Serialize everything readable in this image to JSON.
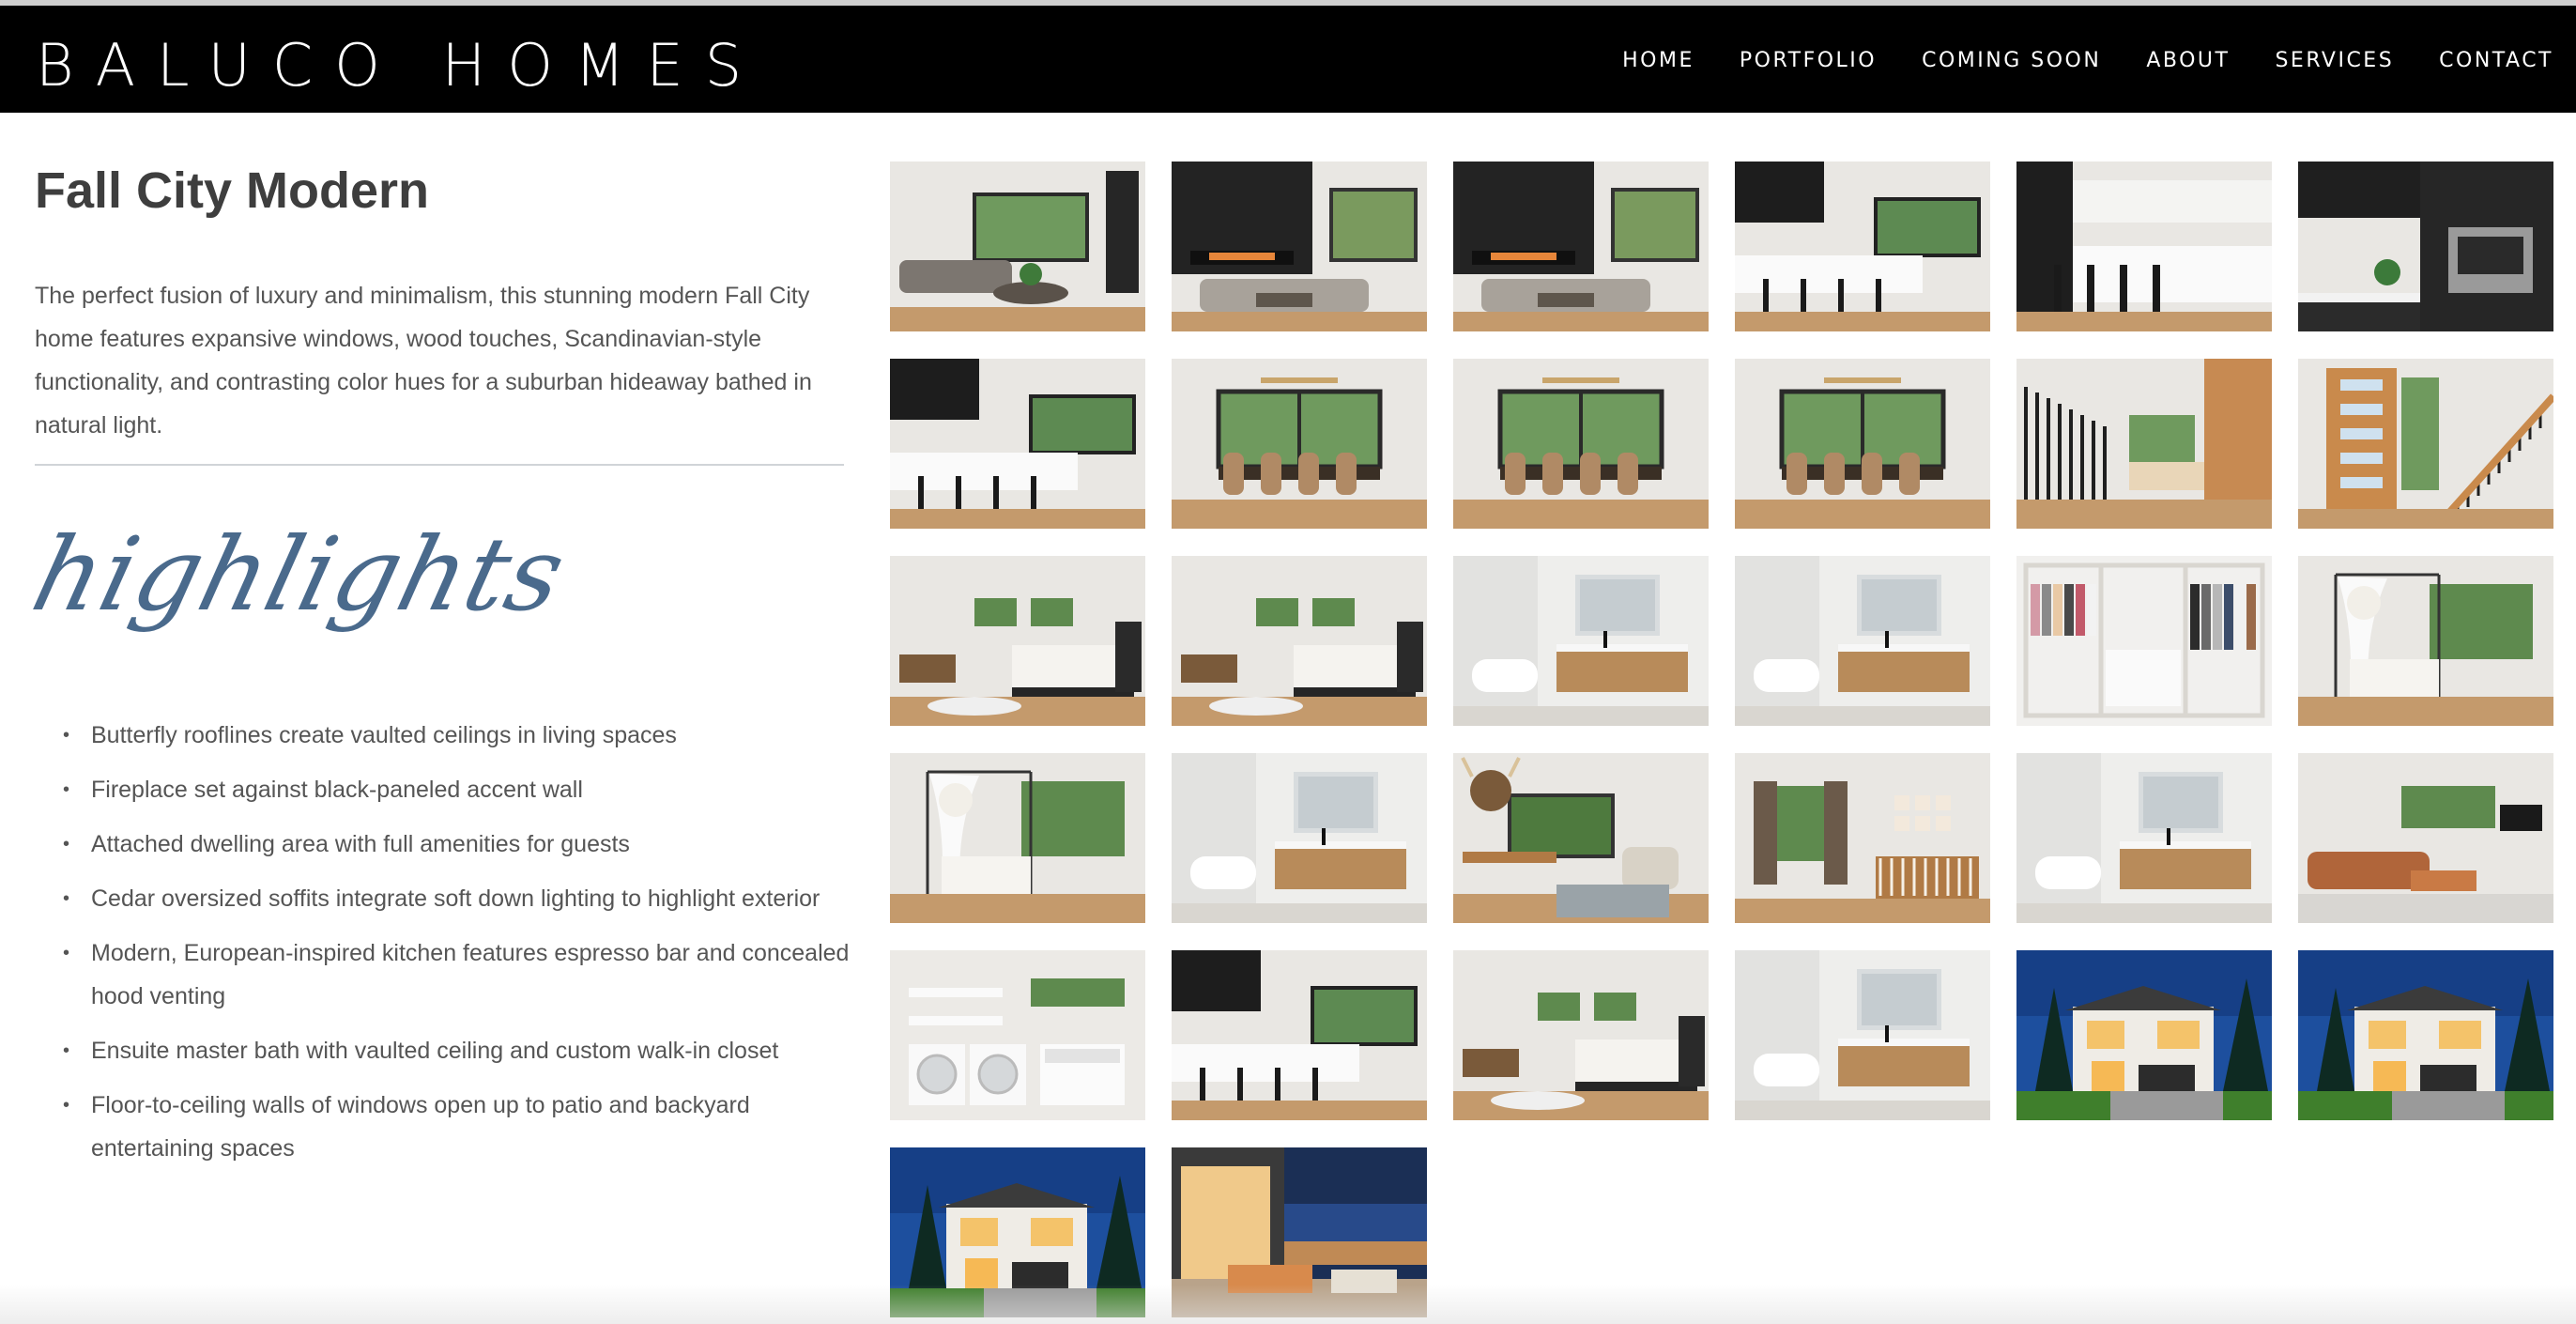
{
  "brand": "BALUCO HOMES",
  "nav": [
    "HOME",
    "PORTFOLIO",
    "COMING SOON",
    "ABOUT",
    "SERVICES",
    "CONTACT"
  ],
  "project": {
    "title": "Fall City Modern",
    "description": "The perfect fusion of luxury and minimalism, this stunning modern Fall City home features expansive windows, wood touches, Scandinavian-style functionality, and contrasting color hues for a suburban hideaway bathed in natural light.",
    "highlights_heading": "highlights",
    "highlights": [
      "Butterfly rooflines create vaulted ceilings in living spaces",
      "Fireplace set against black-paneled accent wall",
      "Attached dwelling area with full amenities for guests",
      "Cedar oversized soffits integrate soft down lighting to highlight exterior",
      "Modern, European-inspired kitchen features espresso bar and concealed hood venting",
      "Ensuite master bath with vaulted ceiling and custom walk-in closet",
      "Floor-to-ceiling walls of windows open up to patio and backyard entertaining spaces"
    ]
  },
  "colors": {
    "header_bg": "#000000",
    "header_text": "#ffffff",
    "script_heading": "#4a6a8c",
    "body_text": "#555555",
    "title_text": "#3e3e3e"
  },
  "gallery": [
    {
      "name": "living-room-photo",
      "scene": "living"
    },
    {
      "name": "living-room-fireplace-photo",
      "scene": "fireplace"
    },
    {
      "name": "living-room-black-wall-photo",
      "scene": "fireplace"
    },
    {
      "name": "kitchen-island-photo",
      "scene": "kitchen"
    },
    {
      "name": "kitchen-black-cabinets-photo",
      "scene": "kitchen-dark"
    },
    {
      "name": "espresso-bar-photo",
      "scene": "espresso"
    },
    {
      "name": "kitchen-dining-view-photo",
      "scene": "kitchen"
    },
    {
      "name": "dining-table-photo",
      "scene": "dining"
    },
    {
      "name": "dining-room-windows-photo",
      "scene": "dining"
    },
    {
      "name": "dining-chandelier-photo",
      "scene": "dining"
    },
    {
      "name": "staircase-photo",
      "scene": "stairs"
    },
    {
      "name": "entry-door-photo",
      "scene": "entry"
    },
    {
      "name": "master-bedroom-photo",
      "scene": "bedroom"
    },
    {
      "name": "master-bedroom-headboard-photo",
      "scene": "bedroom"
    },
    {
      "name": "master-bath-tub-photo",
      "scene": "bath"
    },
    {
      "name": "master-bath-shower-photo",
      "scene": "bath"
    },
    {
      "name": "walk-in-closet-photo",
      "scene": "closet"
    },
    {
      "name": "canopy-bedroom-photo",
      "scene": "canopy"
    },
    {
      "name": "canopy-bed-photo",
      "scene": "canopy"
    },
    {
      "name": "powder-room-photo",
      "scene": "bath"
    },
    {
      "name": "office-photo",
      "scene": "office"
    },
    {
      "name": "nursery-photo",
      "scene": "nursery"
    },
    {
      "name": "guest-bath-photo",
      "scene": "bath"
    },
    {
      "name": "bonus-room-photo",
      "scene": "bonus"
    },
    {
      "name": "laundry-room-photo",
      "scene": "laundry"
    },
    {
      "name": "guest-suite-kitchen-photo",
      "scene": "kitchen"
    },
    {
      "name": "guest-bedroom-photo",
      "scene": "bedroom"
    },
    {
      "name": "guest-suite-bath-photo",
      "scene": "bath"
    },
    {
      "name": "exterior-front-dusk-photo",
      "scene": "exterior"
    },
    {
      "name": "exterior-front-lawn-photo",
      "scene": "exterior"
    },
    {
      "name": "exterior-backyard-photo",
      "scene": "exterior"
    },
    {
      "name": "covered-patio-photo",
      "scene": "patio"
    }
  ]
}
